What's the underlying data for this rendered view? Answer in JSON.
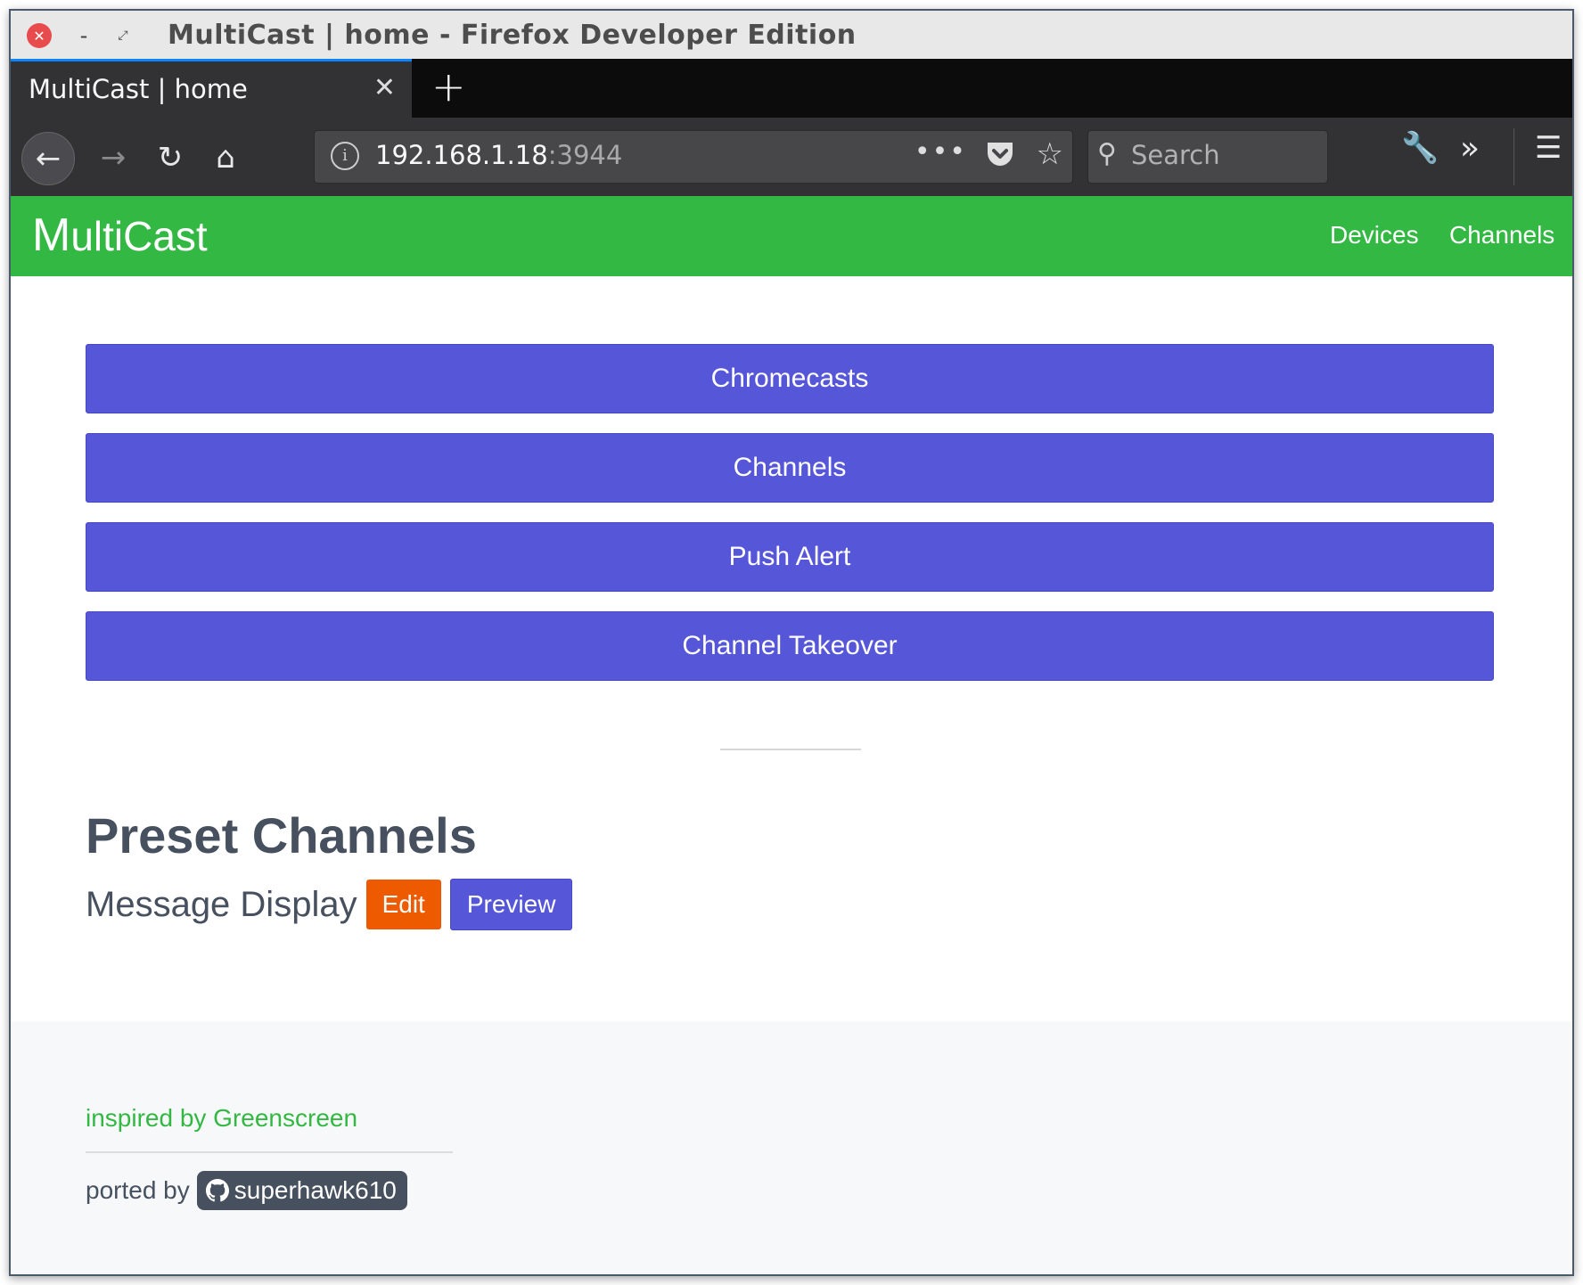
{
  "window": {
    "title": "MultiCast | home - Firefox Developer Edition",
    "close_glyph": "✕",
    "min_glyph": "–",
    "max_glyph": "⤢"
  },
  "tabs": [
    {
      "label": "MultiCast | home",
      "close_glyph": "✕",
      "active": true
    }
  ],
  "newtab_glyph": "+",
  "urlbar": {
    "host": "192.168.1.18",
    "port": ":3944",
    "info_glyph": "i",
    "dots": "•••",
    "star_glyph": "☆"
  },
  "searchbar": {
    "placeholder": "Search",
    "icon_glyph": "⚲"
  },
  "toolbar": {
    "back_glyph": "←",
    "forward_glyph": "→",
    "reload_glyph": "↻",
    "home_glyph": "⌂",
    "wrench_glyph": "🔧",
    "overflow_glyph": "»",
    "menu_glyph": "☰"
  },
  "app": {
    "brand_first": "M",
    "brand_rest": "ultiCast",
    "nav": [
      "Devices",
      "Channels"
    ],
    "brand_color": "#33b843",
    "accent_color": "#5656d9",
    "edit_color": "#ee5a00"
  },
  "actions": [
    "Chromecasts",
    "Channels",
    "Push Alert",
    "Channel Takeover"
  ],
  "presets": {
    "title": "Preset Channels",
    "items": [
      {
        "name": "Message Display",
        "edit_label": "Edit",
        "preview_label": "Preview"
      }
    ]
  },
  "footer": {
    "inspired": "inspired by Greenscreen",
    "ported_prefix": "ported by",
    "github_user": "superhawk610"
  }
}
